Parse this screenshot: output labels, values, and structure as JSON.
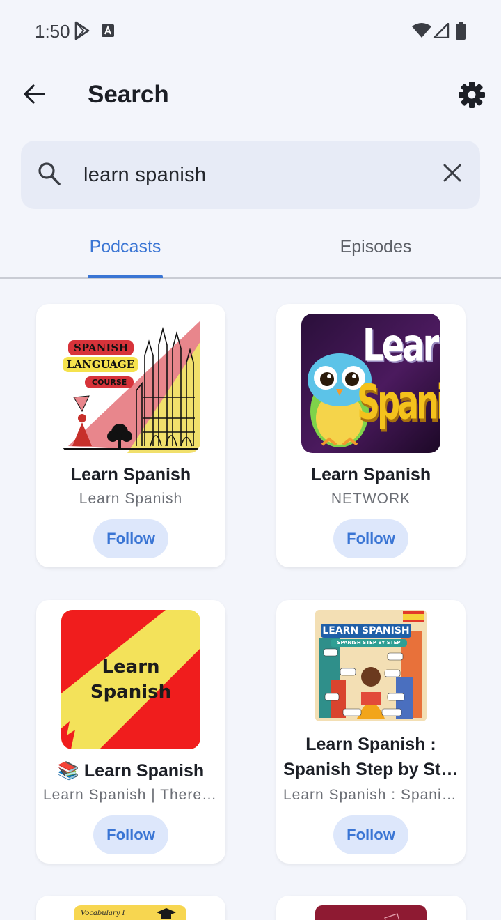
{
  "status_bar": {
    "time": "1:50"
  },
  "header": {
    "title": "Search"
  },
  "search": {
    "value": "learn spanish",
    "placeholder": ""
  },
  "tabs": [
    {
      "label": "Podcasts",
      "selected": true
    },
    {
      "label": "Episodes",
      "selected": false
    }
  ],
  "accent_color": "#3a75d4",
  "podcasts": [
    {
      "title": "Learn Spanish",
      "author": "Learn Spanish",
      "follow_label": "Follow",
      "art": {
        "line1": "SPANISH",
        "line2": "LANGUAGE",
        "line3": "COURSE"
      }
    },
    {
      "title": "Learn Spanish",
      "author": "NETWORK",
      "follow_label": "Follow",
      "art": {
        "line1": "Learn",
        "line2": "Spanish"
      }
    },
    {
      "title": "📚 Learn Spanish",
      "author": "Learn Spanish | Therese Spanish Teacher",
      "follow_label": "Follow",
      "art": {
        "line1": "Learn",
        "line2": "Spanish"
      }
    },
    {
      "title_line1": "Learn Spanish :",
      "title_line2": "Spanish Step by Step",
      "author": "Learn Spanish : Spanish Step by Step",
      "follow_label": "Follow",
      "art": {
        "line1": "LEARN SPANISH",
        "line2": "SPANISH STEP BY STEP"
      }
    },
    {
      "art": {
        "line1": "Vocabulary I"
      }
    }
  ]
}
